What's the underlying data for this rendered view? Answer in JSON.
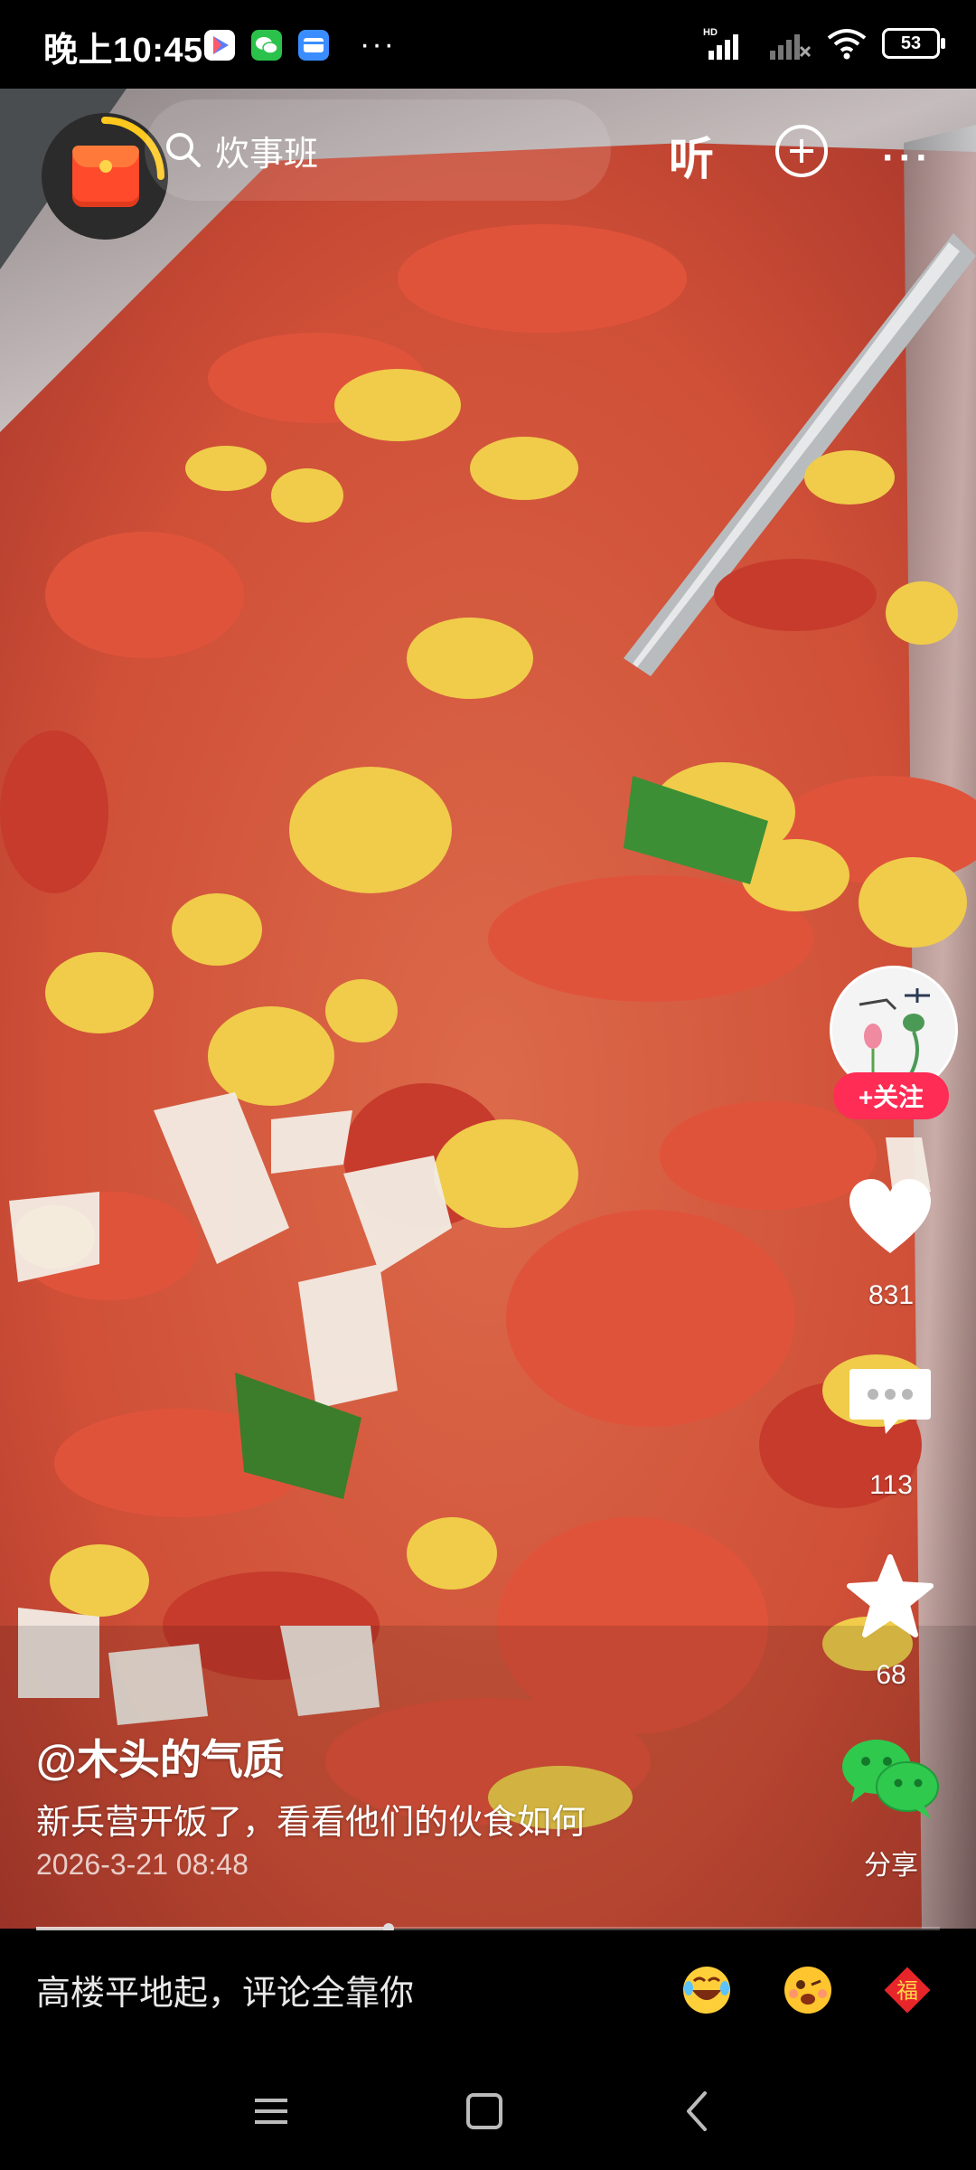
{
  "status_bar": {
    "time": "晚上10:45",
    "app_icons": [
      "play-store-icon",
      "wechat-icon",
      "card-app-icon"
    ],
    "more": "···",
    "network": "HD",
    "battery": "53"
  },
  "top_bar": {
    "search_text": "炊事班",
    "listen_label": "听"
  },
  "right_rail": {
    "follow_label": "+关注",
    "like_count": "831",
    "comment_count": "113",
    "favorite_count": "68",
    "share_label": "分享"
  },
  "caption": {
    "author": "@木头的气质",
    "description": "新兵营开饭了，看看他们的伙食如何",
    "date": "2026-3-21 08:48"
  },
  "progress": {
    "fraction": 0.39
  },
  "comment_bar": {
    "placeholder": "高楼平地起，评论全靠你",
    "emojis": [
      "laughing-emoji-icon",
      "wink-emoji-icon",
      "fu-sticker-icon"
    ],
    "fu_text": "福"
  },
  "colors": {
    "accent": "#ff2c55",
    "redpack": "#ff4b2b",
    "ring": "#ffc81e"
  }
}
